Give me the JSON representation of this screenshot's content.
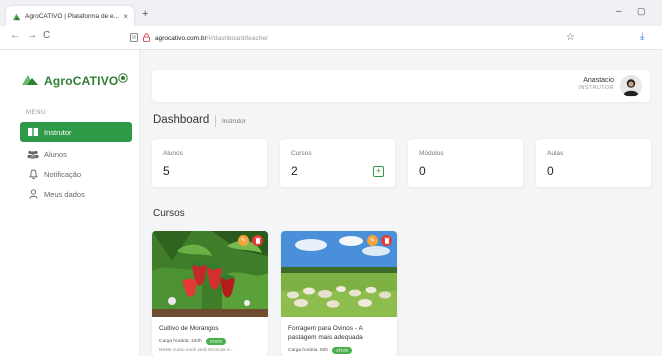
{
  "browser": {
    "tab_title": "AgroCATIVO | Plataforma de e...",
    "tab_close": "×",
    "new_tab": "+",
    "address_host": "agrocativo.com.br",
    "address_path": "/#/dashboard/teacher",
    "back": "←",
    "forward": "→",
    "reload": "C",
    "window_min": "–",
    "window_max": "▢"
  },
  "sidebar": {
    "brand": "AgroCATIVO",
    "menu_label": "MENU",
    "items": [
      {
        "label": "Instrutor",
        "icon": "board-icon",
        "active": true
      },
      {
        "label": "Alunos",
        "icon": "users-icon",
        "active": false
      },
      {
        "label": "Notificação",
        "icon": "bell-icon",
        "active": false
      },
      {
        "label": "Meus dados",
        "icon": "user-icon",
        "active": false
      }
    ]
  },
  "topbar": {
    "user_name": "Anastacio",
    "user_role": "INSTRUTOR"
  },
  "page": {
    "title": "Dashboard",
    "subtitle": "Instrutor",
    "section_title": "Cursos"
  },
  "stats": [
    {
      "label": "Alunos",
      "value": "5"
    },
    {
      "label": "Cursos",
      "value": "2"
    },
    {
      "label": "Módulos",
      "value": "0"
    },
    {
      "label": "Aulas",
      "value": "0"
    }
  ],
  "courses": [
    {
      "name": "Cultivo de Morangos",
      "workload": "Carga horária: 100h",
      "status": "ATIVO",
      "description": "Neste curso você verá técnicas e..."
    },
    {
      "name": "Forragem para Ovinos - A pastagem mais adequada",
      "workload": "Carga horária: 60h",
      "status": "ATIVO",
      "description": ""
    }
  ],
  "colors": {
    "brand_green": "#2e7d32",
    "active_green": "#2e9a47",
    "edit_orange": "#f2a33a",
    "delete_red": "#e53935"
  }
}
